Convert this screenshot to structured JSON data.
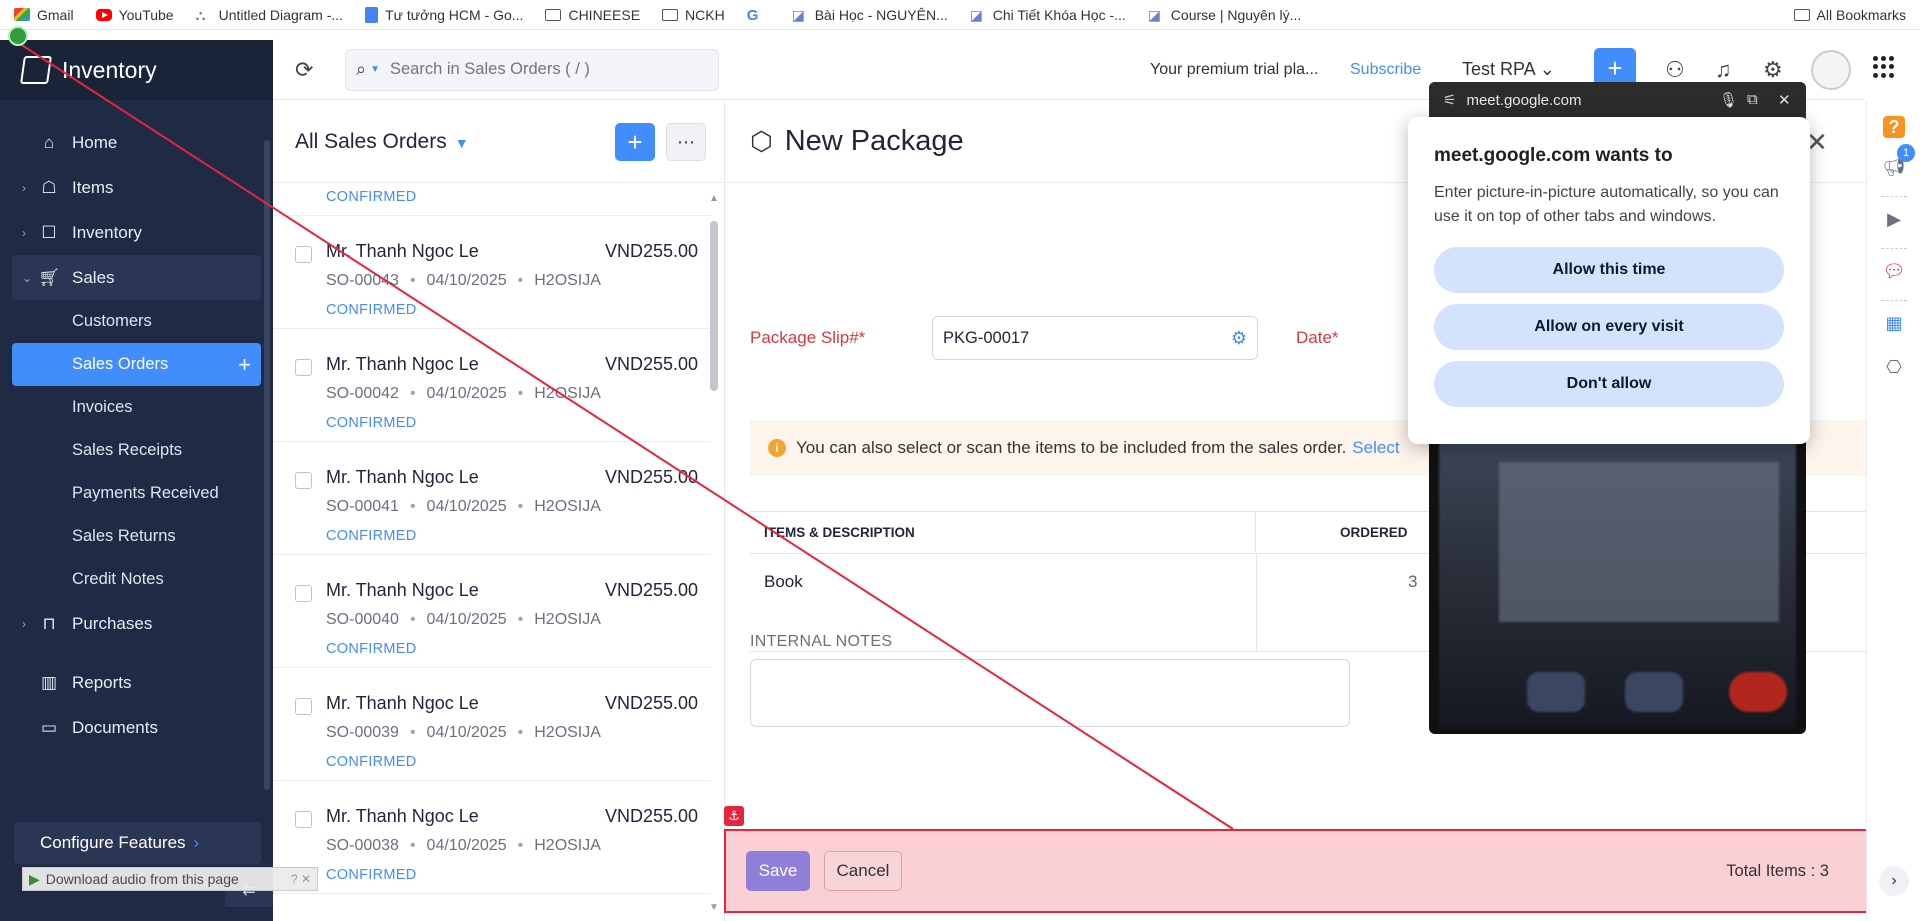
{
  "bookmarks": [
    {
      "label": "Gmail",
      "icon": "gmail-icon"
    },
    {
      "label": "YouTube",
      "icon": "youtube-icon"
    },
    {
      "label": "Untitled Diagram -...",
      "icon": "diagram-icon"
    },
    {
      "label": "Tư tưởng HCM - Go...",
      "icon": "doc-icon"
    },
    {
      "label": "CHINEESE",
      "icon": "folder-icon"
    },
    {
      "label": "NCKH",
      "icon": "folder-icon"
    },
    {
      "label": "",
      "icon": "google-icon"
    },
    {
      "label": "Bài Học - NGUYÊN...",
      "icon": "kiss-icon"
    },
    {
      "label": "Chi Tiết Khóa Học -...",
      "icon": "kiss-icon"
    },
    {
      "label": "Course | Nguyên lý...",
      "icon": "kiss-icon"
    }
  ],
  "all_bookmarks": "All Bookmarks",
  "app": {
    "name": "Inventory"
  },
  "sidebar": {
    "items": [
      {
        "label": "Home",
        "icon": "home-icon"
      },
      {
        "label": "Items",
        "icon": "items-icon"
      },
      {
        "label": "Inventory",
        "icon": "inventory-icon"
      },
      {
        "label": "Sales",
        "icon": "cart-icon"
      }
    ],
    "sales_sub": [
      "Customers",
      "Sales Orders",
      "Invoices",
      "Sales Receipts",
      "Payments Received",
      "Sales Returns",
      "Credit Notes"
    ],
    "bottom_items": [
      {
        "label": "Purchases",
        "icon": "bag-icon"
      },
      {
        "label": "Reports",
        "icon": "reports-icon"
      },
      {
        "label": "Documents",
        "icon": "folder-icon"
      }
    ],
    "configure": "Configure Features",
    "collapse": "⇇"
  },
  "extension": {
    "label": "Download audio from this page"
  },
  "topbar": {
    "search_placeholder": "Search in Sales Orders ( / )",
    "trial": "Your premium trial pla...",
    "subscribe": "Subscribe",
    "org": "Test RPA"
  },
  "list": {
    "title": "All Sales Orders",
    "partial_status": "CONFIRMED",
    "rows": [
      {
        "customer": "Mr. Thanh Ngoc Le",
        "amount": "VND255.00",
        "so": "SO-00043",
        "date": "04/10/2025",
        "ref": "H2OSIJA",
        "status": "CONFIRMED"
      },
      {
        "customer": "Mr. Thanh Ngoc Le",
        "amount": "VND255.00",
        "so": "SO-00042",
        "date": "04/10/2025",
        "ref": "H2OSIJA",
        "status": "CONFIRMED"
      },
      {
        "customer": "Mr. Thanh Ngoc Le",
        "amount": "VND255.00",
        "so": "SO-00041",
        "date": "04/10/2025",
        "ref": "H2OSIJA",
        "status": "CONFIRMED"
      },
      {
        "customer": "Mr. Thanh Ngoc Le",
        "amount": "VND255.00",
        "so": "SO-00040",
        "date": "04/10/2025",
        "ref": "H2OSIJA",
        "status": "CONFIRMED"
      },
      {
        "customer": "Mr. Thanh Ngoc Le",
        "amount": "VND255.00",
        "so": "SO-00039",
        "date": "04/10/2025",
        "ref": "H2OSIJA",
        "status": "CONFIRMED"
      },
      {
        "customer": "Mr. Thanh Ngoc Le",
        "amount": "VND255.00",
        "so": "SO-00038",
        "date": "04/10/2025",
        "ref": "H2OSIJA",
        "status": "CONFIRMED"
      }
    ]
  },
  "form": {
    "title": "New Package",
    "slip_label": "Package Slip#*",
    "slip_value": "PKG-00017",
    "date_label": "Date*",
    "info_text": "You can also select or scan the items to be included from the sales order.",
    "info_link": "Select",
    "col_items": "ITEMS & DESCRIPTION",
    "col_ordered": "ORDERED",
    "item_name": "Book",
    "item_qty": "3",
    "notes_label": "INTERNAL NOTES"
  },
  "footer": {
    "save": "Save",
    "cancel": "Cancel",
    "total_items": "Total Items : 3"
  },
  "pip": {
    "domain": "meet.google.com"
  },
  "permission": {
    "title": "meet.google.com wants to",
    "body": "Enter picture-in-picture automatically, so you can use it on top of other tabs and windows.",
    "buttons": [
      "Allow this time",
      "Allow on every visit",
      "Don't allow"
    ]
  },
  "rail": {
    "badge_count": "1"
  },
  "colors": {
    "sidebar": "#1f2a44",
    "accent": "#408dfb",
    "required": "#d6393f",
    "highlight": "#e8243c"
  }
}
